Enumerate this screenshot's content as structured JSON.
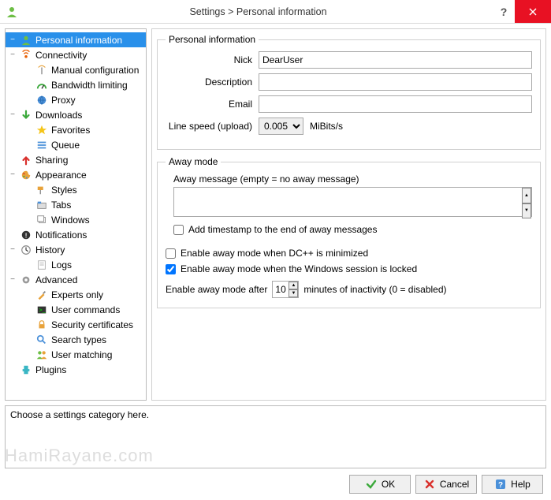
{
  "window": {
    "title": "Settings > Personal information"
  },
  "sidebar": {
    "items": [
      {
        "label": "Personal information",
        "level": 0,
        "exp": "−",
        "selected": true,
        "icon": "person"
      },
      {
        "label": "Connectivity",
        "level": 0,
        "exp": "−",
        "selected": false,
        "icon": "signal"
      },
      {
        "label": "Manual configuration",
        "level": 1,
        "exp": "",
        "selected": false,
        "icon": "antenna"
      },
      {
        "label": "Bandwidth limiting",
        "level": 1,
        "exp": "",
        "selected": false,
        "icon": "dial"
      },
      {
        "label": "Proxy",
        "level": 1,
        "exp": "",
        "selected": false,
        "icon": "globe"
      },
      {
        "label": "Downloads",
        "level": 0,
        "exp": "−",
        "selected": false,
        "icon": "down"
      },
      {
        "label": "Favorites",
        "level": 1,
        "exp": "",
        "selected": false,
        "icon": "star"
      },
      {
        "label": "Queue",
        "level": 1,
        "exp": "",
        "selected": false,
        "icon": "queue"
      },
      {
        "label": "Sharing",
        "level": 0,
        "exp": "",
        "selected": false,
        "icon": "up"
      },
      {
        "label": "Appearance",
        "level": 0,
        "exp": "−",
        "selected": false,
        "icon": "palette"
      },
      {
        "label": "Styles",
        "level": 1,
        "exp": "",
        "selected": false,
        "icon": "paint"
      },
      {
        "label": "Tabs",
        "level": 1,
        "exp": "",
        "selected": false,
        "icon": "tabs"
      },
      {
        "label": "Windows",
        "level": 1,
        "exp": "",
        "selected": false,
        "icon": "windows"
      },
      {
        "label": "Notifications",
        "level": 0,
        "exp": "",
        "selected": false,
        "icon": "bell"
      },
      {
        "label": "History",
        "level": 0,
        "exp": "−",
        "selected": false,
        "icon": "clock"
      },
      {
        "label": "Logs",
        "level": 1,
        "exp": "",
        "selected": false,
        "icon": "logs"
      },
      {
        "label": "Advanced",
        "level": 0,
        "exp": "−",
        "selected": false,
        "icon": "gear"
      },
      {
        "label": "Experts only",
        "level": 1,
        "exp": "",
        "selected": false,
        "icon": "tools"
      },
      {
        "label": "User commands",
        "level": 1,
        "exp": "",
        "selected": false,
        "icon": "terminal"
      },
      {
        "label": "Security certificates",
        "level": 1,
        "exp": "",
        "selected": false,
        "icon": "lock"
      },
      {
        "label": "Search types",
        "level": 1,
        "exp": "",
        "selected": false,
        "icon": "search"
      },
      {
        "label": "User matching",
        "level": 1,
        "exp": "",
        "selected": false,
        "icon": "users"
      },
      {
        "label": "Plugins",
        "level": 0,
        "exp": "",
        "selected": false,
        "icon": "plugin"
      }
    ]
  },
  "personal": {
    "legend": "Personal information",
    "nick_label": "Nick",
    "nick_value": "DearUser",
    "desc_label": "Description",
    "desc_value": "",
    "email_label": "Email",
    "email_value": "",
    "speed_label": "Line speed (upload)",
    "speed_value": "0.005",
    "speed_unit": "MiBits/s"
  },
  "away": {
    "legend": "Away mode",
    "msg_label": "Away message (empty = no away message)",
    "msg_value": "",
    "timestamp_label": "Add timestamp to the end of away messages",
    "timestamp_checked": false,
    "minimize_label": "Enable away mode when DC++ is minimized",
    "minimize_checked": false,
    "locked_label": "Enable away mode when the Windows session is locked",
    "locked_checked": true,
    "inactivity_prefix": "Enable away mode after",
    "inactivity_value": "10",
    "inactivity_suffix": "minutes of inactivity (0 = disabled)"
  },
  "helpbox": {
    "text": "Choose a settings category here."
  },
  "footer": {
    "ok": "OK",
    "cancel": "Cancel",
    "help": "Help"
  },
  "watermark": "HamiRayane.com"
}
